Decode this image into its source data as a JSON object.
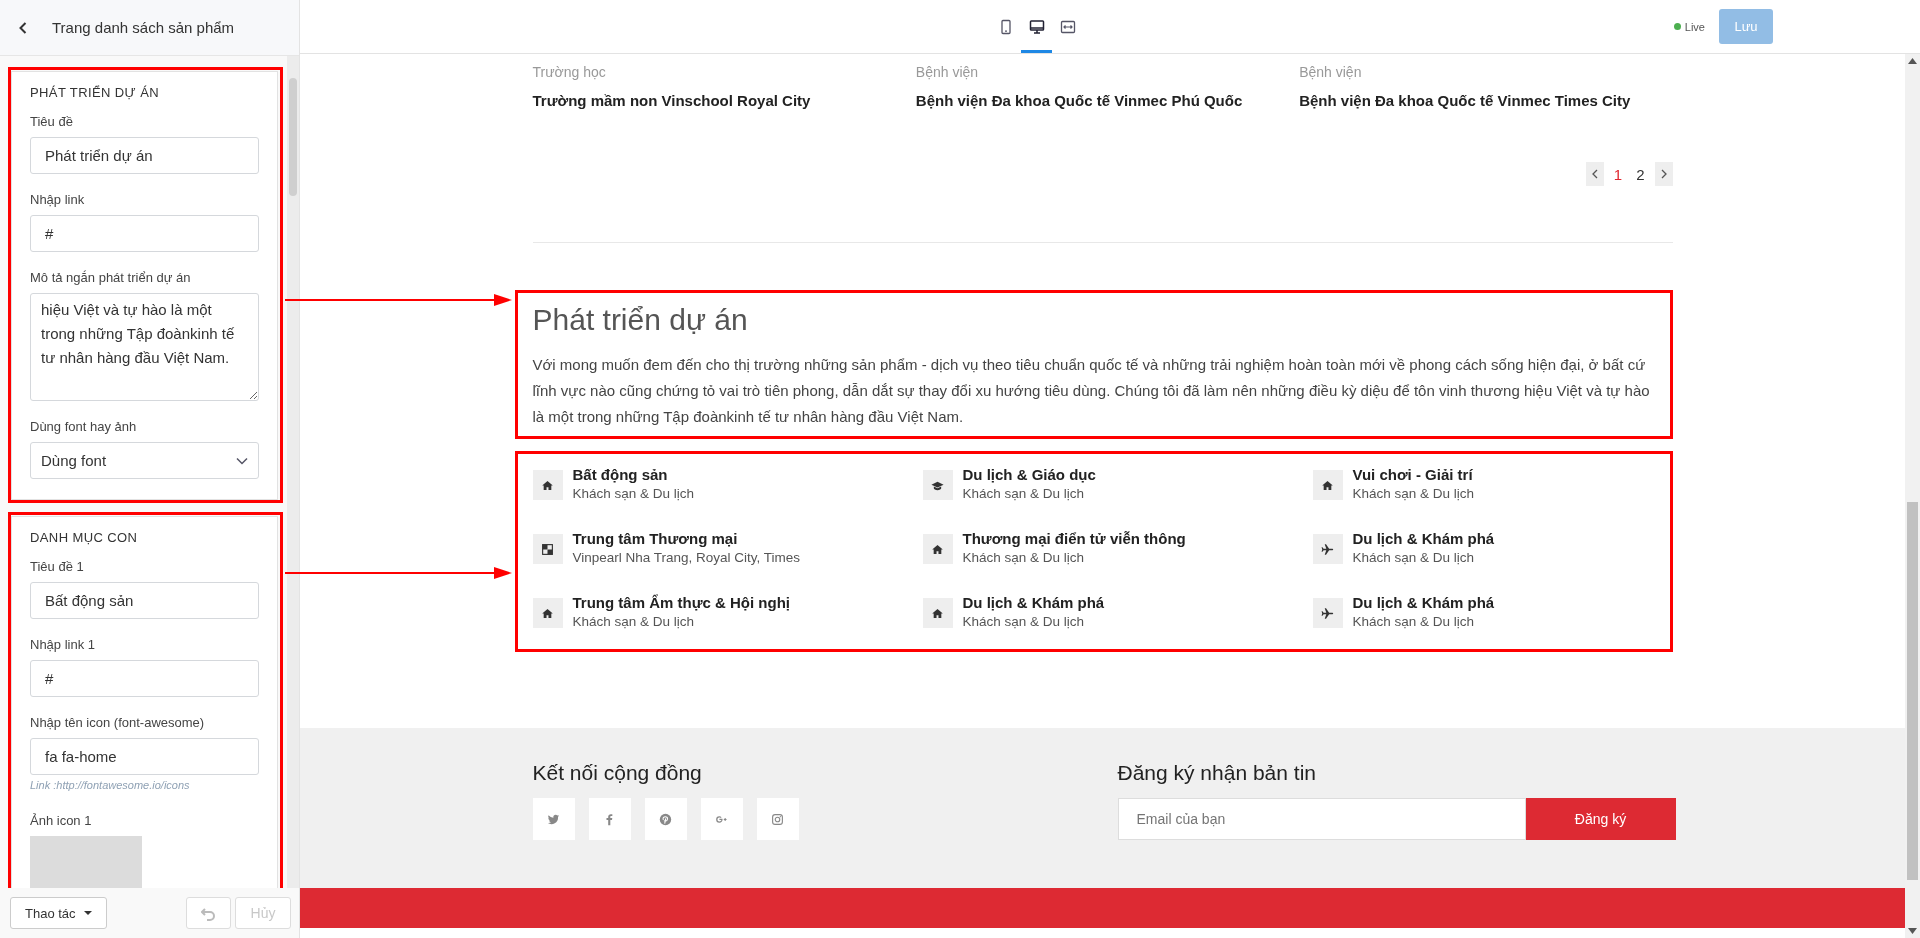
{
  "sidebar": {
    "title": "Trang danh sách sản phẩm",
    "panels": [
      {
        "title": "PHÁT TRIỂN DỰ ÁN",
        "highlighted": true,
        "fields": [
          {
            "kind": "text",
            "label": "Tiêu đề",
            "value": "Phát triển dự án"
          },
          {
            "kind": "text",
            "label": "Nhập link",
            "value": "#"
          },
          {
            "kind": "textarea",
            "label": "Mô tả ngắn phát triển dự án",
            "value": "hiệu Việt và tự hào là một trong những Tập đoànkinh tế tư nhân hàng đầu Việt Nam."
          },
          {
            "kind": "select",
            "label": "Dùng font hay ảnh",
            "value": "Dùng font"
          }
        ]
      },
      {
        "title": "DANH MỤC CON",
        "highlighted": true,
        "fields": [
          {
            "kind": "text",
            "label": "Tiêu đề 1",
            "value": "Bất động sản"
          },
          {
            "kind": "text",
            "label": "Nhập link 1",
            "value": "#"
          },
          {
            "kind": "text",
            "label": "Nhập tên icon (font-awesome)",
            "value": "fa fa-home",
            "hint": "Link :http://fontawesome.io/icons"
          },
          {
            "kind": "image",
            "label": "Ảnh icon 1"
          }
        ]
      }
    ],
    "actions_button": "Thao tác",
    "undo_button": {
      "disabled": true
    },
    "cancel_button": {
      "label": "Hủy",
      "disabled": true
    }
  },
  "toolbar": {
    "devices": [
      {
        "kind": "mobile",
        "selected": false
      },
      {
        "kind": "desktop",
        "selected": true
      },
      {
        "kind": "fit-width",
        "selected": false
      }
    ],
    "status": "Live",
    "save_button": "Lưu"
  },
  "page": {
    "projects": [
      {
        "category": "Trường học",
        "name": "Trường mầm non Vinschool Royal City"
      },
      {
        "category": "Bệnh viện",
        "name": "Bệnh viện Đa khoa Quốc tế Vinmec Phú Quốc"
      },
      {
        "category": "Bệnh viện",
        "name": "Bệnh viện Đa khoa Quốc tế Vinmec Times City"
      }
    ],
    "pagination": [
      {
        "label": "1",
        "selected": true
      },
      {
        "label": "2",
        "selected": false
      }
    ],
    "intro": {
      "highlighted": true,
      "heading": "Phát triển dự án",
      "text": "Với mong muốn đem đến cho thị trường những sản phẩm - dịch vụ theo tiêu chuẩn quốc tế và những trải nghiệm hoàn toàn mới về phong cách sống hiện đại, ở bất cứ lĩnh vực nào cũng chứng tỏ vai trò tiên phong, dẫn dắt sự thay đổi xu hướng tiêu dùng. Chúng tôi đã làm nên những điều kỳ diệu để tôn vinh thương hiệu Việt và tự hào là một trong những Tập đoànkinh tế tư nhân hàng đầu Việt Nam."
    },
    "categories": {
      "highlighted": true,
      "items": [
        {
          "kind": "home",
          "title": "Bất động sản",
          "subtitle": "Khách sạn & Du lịch"
        },
        {
          "kind": "graduation-cap",
          "title": "Du lịch & Giáo dục",
          "subtitle": "Khách sạn & Du lịch"
        },
        {
          "kind": "home",
          "title": "Vui chơi - Giải trí",
          "subtitle": "Khách sạn & Du lịch"
        },
        {
          "kind": "checkered-square",
          "title": "Trung tâm Thương mại",
          "subtitle": "Vinpearl Nha Trang, Royal City, Times"
        },
        {
          "kind": "home",
          "title": "Thương mại điển tử viễn thông",
          "subtitle": "Khách sạn & Du lịch"
        },
        {
          "kind": "airplane",
          "title": "Du lịch & Khám phá",
          "subtitle": "Khách sạn & Du lịch"
        },
        {
          "kind": "home",
          "title": "Trung tâm Ẩm thực & Hội nghị",
          "subtitle": "Khách sạn & Du lịch"
        },
        {
          "kind": "home",
          "title": "Du lịch & Khám phá",
          "subtitle": "Khách sạn & Du lịch"
        },
        {
          "kind": "airplane",
          "title": "Du lịch & Khám phá",
          "subtitle": "Khách sạn & Du lịch"
        }
      ]
    },
    "footer": {
      "social_heading": "Kết nối cộng đồng",
      "socials": [
        {
          "kind": "twitter"
        },
        {
          "kind": "facebook"
        },
        {
          "kind": "pinterest"
        },
        {
          "kind": "google-plus"
        },
        {
          "kind": "instagram"
        }
      ],
      "newsletter_heading": "Đăng ký nhận bản tin",
      "email_placeholder": "Email của bạn",
      "subscribe_button": "Đăng ký"
    }
  }
}
